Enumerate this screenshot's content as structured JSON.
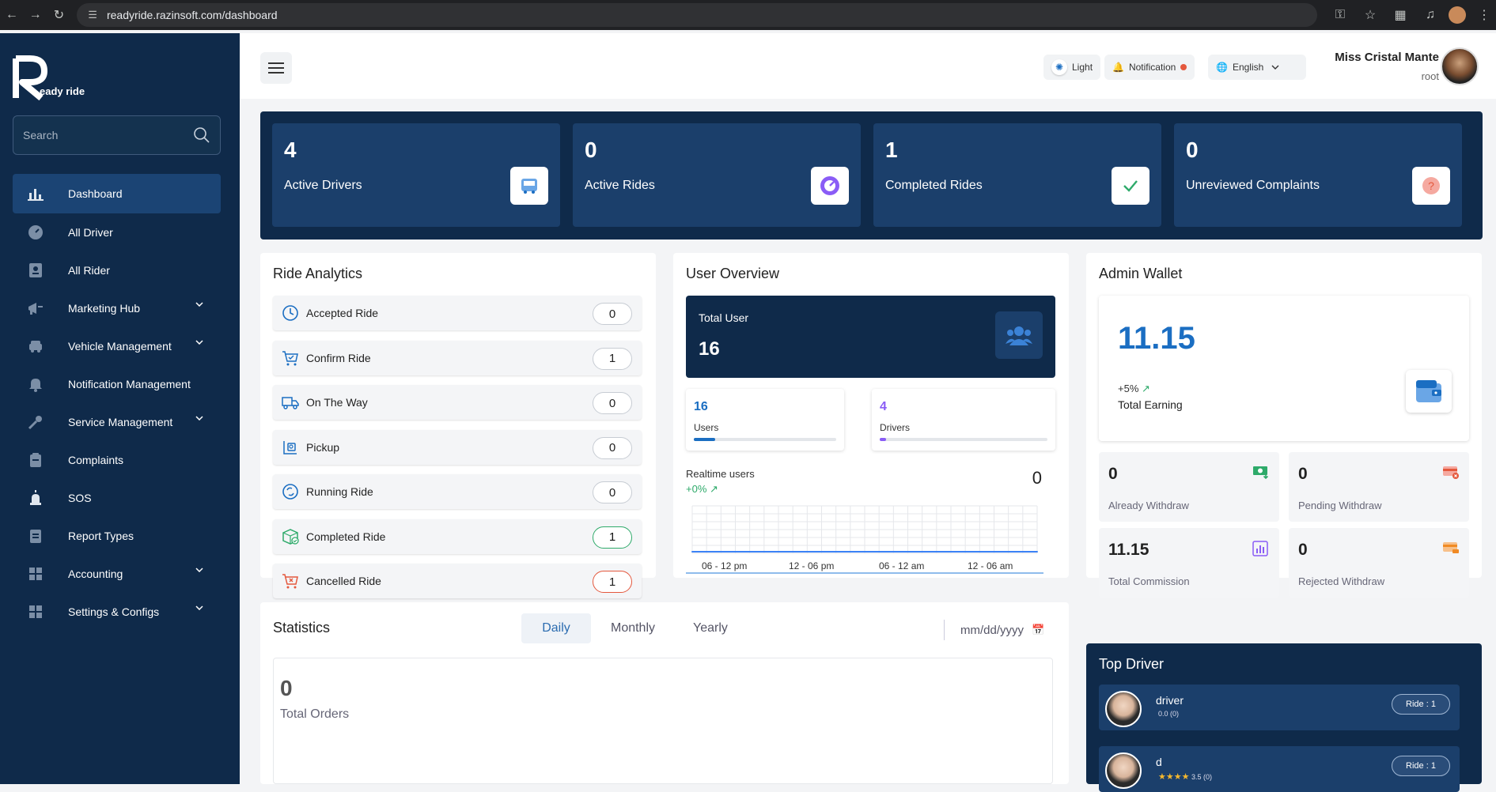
{
  "browser": {
    "url": "readyride.razinsoft.com/dashboard"
  },
  "sidebar": {
    "logo_text": "eady ride",
    "search_placeholder": "Search",
    "items": [
      {
        "label": "Dashboard",
        "icon": "chart-bars-icon",
        "active": true
      },
      {
        "label": "All Driver",
        "icon": "speedometer-icon"
      },
      {
        "label": "All Rider",
        "icon": "badge-icon"
      },
      {
        "label": "Marketing Hub",
        "icon": "megaphone-icon",
        "expandable": true
      },
      {
        "label": "Vehicle Management",
        "icon": "car-icon",
        "expandable": true
      },
      {
        "label": "Notification Management",
        "icon": "bell-icon"
      },
      {
        "label": "Service Management",
        "icon": "wrench-icon",
        "expandable": true
      },
      {
        "label": "Complaints",
        "icon": "clipboard-icon"
      },
      {
        "label": "SOS",
        "icon": "siren-icon"
      },
      {
        "label": "Report Types",
        "icon": "document-icon"
      },
      {
        "label": "Accounting",
        "icon": "grid-icon",
        "expandable": true
      },
      {
        "label": "Settings & Configs",
        "icon": "grid-icon",
        "expandable": true
      }
    ]
  },
  "topbar": {
    "theme_label": "Light",
    "notification_label": "Notification",
    "language_label": "English",
    "user_name": "Miss Cristal Mante",
    "user_role": "root"
  },
  "stats": [
    {
      "value": "4",
      "label": "Active Drivers",
      "icon": "bus-icon"
    },
    {
      "value": "0",
      "label": "Active Rides",
      "icon": "gauge-icon"
    },
    {
      "value": "1",
      "label": "Completed Rides",
      "icon": "check-icon"
    },
    {
      "value": "0",
      "label": "Unreviewed Complaints",
      "icon": "question-icon"
    }
  ],
  "ride_analytics": {
    "title": "Ride Analytics",
    "rows": [
      {
        "label": "Accepted Ride",
        "count": "0",
        "icon": "clock-icon"
      },
      {
        "label": "Confirm Ride",
        "count": "1",
        "icon": "cart-check-icon"
      },
      {
        "label": "On The Way",
        "count": "0",
        "icon": "truck-icon"
      },
      {
        "label": "Pickup",
        "count": "0",
        "icon": "pickup-icon"
      },
      {
        "label": "Running Ride",
        "count": "0",
        "icon": "refresh-icon"
      },
      {
        "label": "Completed Ride",
        "count": "1",
        "icon": "box-check-icon"
      },
      {
        "label": "Cancelled Ride",
        "count": "1",
        "icon": "cart-x-icon"
      }
    ]
  },
  "user_overview": {
    "title": "User Overview",
    "total_user_label": "Total User",
    "total_user_value": "16",
    "users_value": "16",
    "users_label": "Users",
    "users_progress": 0.15,
    "drivers_value": "4",
    "drivers_label": "Drivers",
    "drivers_progress": 0.04,
    "realtime_label": "Realtime users",
    "realtime_change": "+0%",
    "realtime_value": "0"
  },
  "chart_data": {
    "type": "line",
    "categories": [
      "06 - 12 pm",
      "12 - 06 pm",
      "06 - 12 am",
      "12 - 06 am"
    ],
    "series": [
      {
        "values": [
          0,
          0,
          0,
          0
        ]
      }
    ],
    "grid": true,
    "title": "",
    "xlabel": "",
    "ylabel": ""
  },
  "admin_wallet": {
    "title": "Admin Wallet",
    "total_value": "11.15",
    "change": "+5%",
    "total_label": "Total Earning",
    "cards": [
      {
        "value": "0",
        "label": "Already Withdraw",
        "icon": "money-icon",
        "color": "#2eaa6a"
      },
      {
        "value": "0",
        "label": "Pending Withdraw",
        "icon": "card-x-icon",
        "color": "#e4583d"
      },
      {
        "value": "11.15",
        "label": "Total Commission",
        "icon": "bar-chart-icon",
        "color": "#8a5cf6"
      },
      {
        "value": "0",
        "label": "Rejected Withdraw",
        "icon": "card-icon",
        "color": "#f08a24"
      }
    ]
  },
  "statistics": {
    "title": "Statistics",
    "tabs": [
      "Daily",
      "Monthly",
      "Yearly"
    ],
    "date_placeholder": "mm/dd/yyyy",
    "total_orders_value": "0",
    "total_orders_label": "Total Orders"
  },
  "top_driver": {
    "title": "Top Driver",
    "drivers": [
      {
        "name": "driver",
        "rating": "0.0 (0)",
        "rides": "Ride : 1"
      },
      {
        "name": "d",
        "rating": "3.5 (0)",
        "rides": "Ride : 1"
      }
    ]
  },
  "colors": {
    "sidebar": "#0f2a4a",
    "accent": "#1b6ec2",
    "card": "#1b3f6b"
  }
}
